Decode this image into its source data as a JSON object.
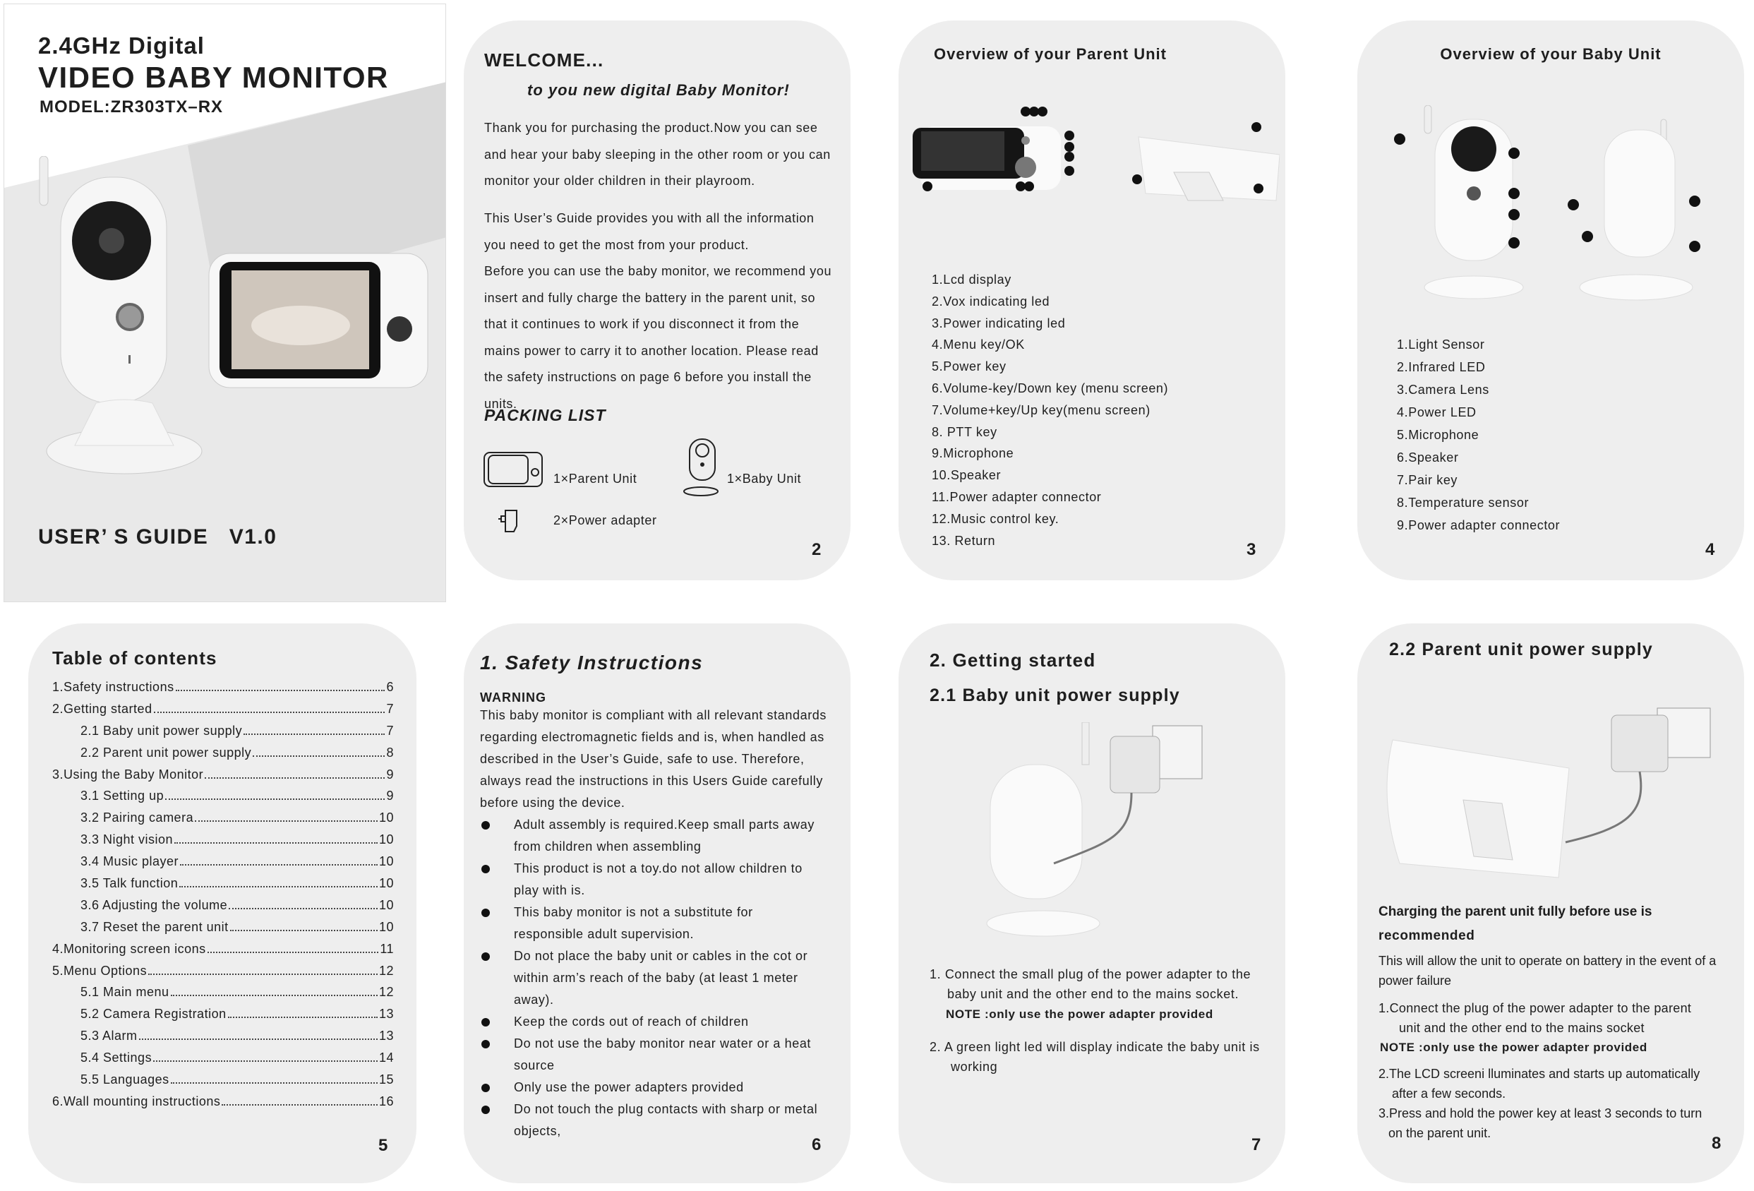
{
  "cover": {
    "line1": "2.4GHz Digital",
    "title": "VIDEO BABY MONITOR",
    "model": "MODEL:ZR303TX–RX",
    "guide": "USER’ S GUIDE   V1.0"
  },
  "p2": {
    "title": "WELCOME...",
    "subtitle": "to you new digital Baby Monitor!",
    "para1": "Thank you for purchasing the product.Now you can see and hear your baby sleeping in the other room or you can monitor your older children in their playroom.",
    "para2": "This User’s Guide provides you with all the information you need to get the most from your product.",
    "para3": "Before you can use the baby monitor, we recommend you insert and fully charge the battery in the parent unit, so that it continues to work if you disconnect it from the mains power to carry it to another location. Please read the safety instructions on page 6 before you install the units.",
    "packing_title": "PACKING LIST",
    "parent_unit": "1×Parent Unit",
    "baby_unit": "1×Baby Unit",
    "adapter": "2×Power adapter",
    "page": "2"
  },
  "p3": {
    "title": "Overview of your Parent Unit",
    "items": [
      "1.Lcd display",
      "2.Vox indicating led",
      "3.Power indicating led",
      "4.Menu key/OK",
      "5.Power key",
      "6.Volume-key/Down key (menu screen)",
      "7.Volume+key/Up key(menu screen)",
      "8. PTT key",
      "9.Microphone",
      "10.Speaker",
      "11.Power adapter connector",
      "12.Music control key.",
      "13. Return"
    ],
    "page": "3"
  },
  "p4": {
    "title": "Overview of your Baby Unit",
    "items": [
      "1.Light Sensor",
      "2.Infrared LED",
      "3.Camera Lens",
      "4.Power LED",
      "5.Microphone",
      "6.Speaker",
      "7.Pair key",
      "8.Temperature sensor",
      "9.Power adapter connector"
    ],
    "page": "4"
  },
  "p5": {
    "title": "Table of contents",
    "entries": [
      {
        "label": "1.Safety instructions",
        "page": "6",
        "indent": false
      },
      {
        "label": "2.Getting started",
        "page": "7",
        "indent": false
      },
      {
        "label": "2.1 Baby unit power supply",
        "page": "7",
        "indent": true
      },
      {
        "label": "2.2 Parent unit power supply",
        "page": "8",
        "indent": true
      },
      {
        "label": "3.Using the Baby Monitor",
        "page": "9",
        "indent": false
      },
      {
        "label": "3.1 Setting up",
        "page": "9",
        "indent": true
      },
      {
        "label": "3.2 Pairing camera",
        "page": "10",
        "indent": true
      },
      {
        "label": "3.3 Night vision",
        "page": "10",
        "indent": true
      },
      {
        "label": "3.4 Music player",
        "page": "10",
        "indent": true
      },
      {
        "label": "3.5 Talk function",
        "page": "10",
        "indent": true
      },
      {
        "label": "3.6 Adjusting the volume",
        "page": "10",
        "indent": true
      },
      {
        "label": "3.7 Reset the parent unit",
        "page": "10",
        "indent": true
      },
      {
        "label": "4.Monitoring screen icons",
        "page": "11",
        "indent": false
      },
      {
        "label": "5.Menu Options",
        "page": "12",
        "indent": false
      },
      {
        "label": "5.1 Main menu",
        "page": "12",
        "indent": true
      },
      {
        "label": "5.2 Camera Registration",
        "page": "13",
        "indent": true
      },
      {
        "label": "5.3 Alarm",
        "page": "13",
        "indent": true
      },
      {
        "label": "5.4 Settings",
        "page": "14",
        "indent": true
      },
      {
        "label": "5.5 Languages",
        "page": "15",
        "indent": true
      },
      {
        "label": "6.Wall mounting instructions",
        "page": "16",
        "indent": false
      }
    ],
    "page": "5"
  },
  "p6": {
    "title": "1. Safety Instructions",
    "warning": "WARNING",
    "intro": "This baby monitor is compliant with all relevant standards regarding electromagnetic fields and is, when handled as described in the User’s Guide, safe to use. Therefore, always read the instructions in this Users Guide carefully before using the device.",
    "bullets": [
      "Adult assembly is required.Keep small parts away from children when assembling",
      "This product is not a toy.do not allow children to play with is.",
      "This baby monitor is not a substitute for responsible adult  supervision.",
      "Do not place the baby unit or cables in the cot or within arm’s reach of the baby (at least 1 meter away).",
      "Keep the cords out of reach of children",
      "Do not use the baby monitor near  water  or  a  heat source",
      "Only use the power adapters provided",
      "Do not touch the plug contacts with sharp or metal objects,"
    ],
    "page": "6"
  },
  "p7": {
    "title": "2. Getting started",
    "subtitle": "2.1 Baby unit power supply",
    "step1": "1.  Connect the small plug of the power adapter to the",
    "step1b": "baby unit and the other end to  the mains socket.",
    "note": "NOTE :only use the power adapter provided",
    "step2": "2.  A green light led will display  indicate  the baby unit is",
    "step2b": "working",
    "page": "7"
  },
  "p8": {
    "title": "2.2 Parent unit power supply",
    "charging1": "Charging the parent unit  fully before use is",
    "charging2": "recommended",
    "info1": "This will allow the unit to operate on battery in the event of a",
    "info2": "power failure",
    "step1": "1.Connect the plug of the power adapter to the parent",
    "step1b": "unit and the other end to the mains socket",
    "note": "NOTE :only use the power adapter provided",
    "step2": "2.The LCD screeni lluminates and starts up automatically",
    "step2b": "after a few seconds.",
    "step3": "3.Press and hold the power key at least 3 seconds to turn",
    "step3b": "on the parent unit.",
    "page": "8"
  }
}
